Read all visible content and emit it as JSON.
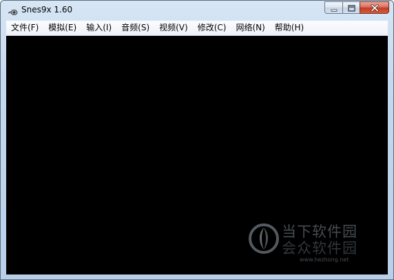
{
  "window": {
    "title": "Snes9x 1.60"
  },
  "icons": {
    "app": "snes-controller-icon",
    "minimize": "minimize-icon",
    "maximize": "maximize-icon",
    "close": "close-icon",
    "watermark_logo": "watermark-logo-icon"
  },
  "menu": {
    "items": [
      {
        "label": "文件(F)"
      },
      {
        "label": "模拟(E)"
      },
      {
        "label": "输入(I)"
      },
      {
        "label": "音频(S)"
      },
      {
        "label": "视频(V)"
      },
      {
        "label": "修改(C)"
      },
      {
        "label": "网络(N)"
      },
      {
        "label": "帮助(H)"
      }
    ]
  },
  "watermark": {
    "line1": "当下软件园",
    "line2": "会众软件园",
    "url": "www.hezhong.net"
  },
  "colors": {
    "screen": "#000000",
    "close_button": "#c23f24",
    "frame": "#c4d8ee"
  }
}
